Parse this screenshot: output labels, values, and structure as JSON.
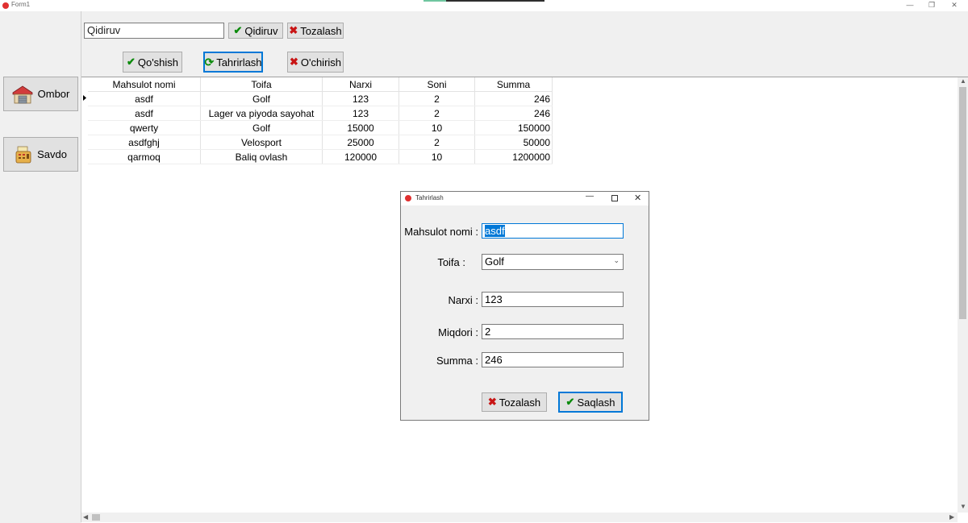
{
  "window": {
    "title": "Form1",
    "minimize": "—",
    "restore": "❐",
    "close": "✕"
  },
  "search": {
    "value": "Qidiruv",
    "search_label": "Qidiruv",
    "clear_label": "Tozalash"
  },
  "toolbar": {
    "add_label": "Qo'shish",
    "edit_label": "Tahrirlash",
    "delete_label": "O'chirish"
  },
  "sidebar": {
    "items": [
      {
        "label": "Ombor",
        "icon": "warehouse-icon"
      },
      {
        "label": "Savdo",
        "icon": "cash-register-icon"
      }
    ]
  },
  "grid": {
    "columns": [
      "Mahsulot nomi",
      "Toifa",
      "Narxi",
      "Soni",
      "Summa"
    ],
    "rows": [
      [
        "asdf",
        "Golf",
        "123",
        "2",
        "246"
      ],
      [
        "asdf",
        "Lager va piyoda sayohat",
        "123",
        "2",
        "246"
      ],
      [
        "qwerty",
        "Golf",
        "15000",
        "10",
        "150000"
      ],
      [
        "asdfghj",
        "Velosport",
        "25000",
        "2",
        "50000"
      ],
      [
        "qarmoq",
        "Baliq ovlash",
        "120000",
        "10",
        "1200000"
      ]
    ]
  },
  "dialog": {
    "title": "Tahrirlash",
    "name_label": "Mahsulot nomi :",
    "name_value": "asdf",
    "category_label": "Toifa :",
    "category_value": "Golf",
    "price_label": "Narxi :",
    "price_value": "123",
    "qty_label": "Miqdori :",
    "qty_value": "2",
    "sum_label": "Summa :",
    "sum_value": "246",
    "clear_label": "Tozalash",
    "save_label": "Saqlash"
  },
  "colors": {
    "accent": "#0078d7",
    "check": "#0a8a0a",
    "cross": "#c81414",
    "selection": "#0078d7"
  }
}
